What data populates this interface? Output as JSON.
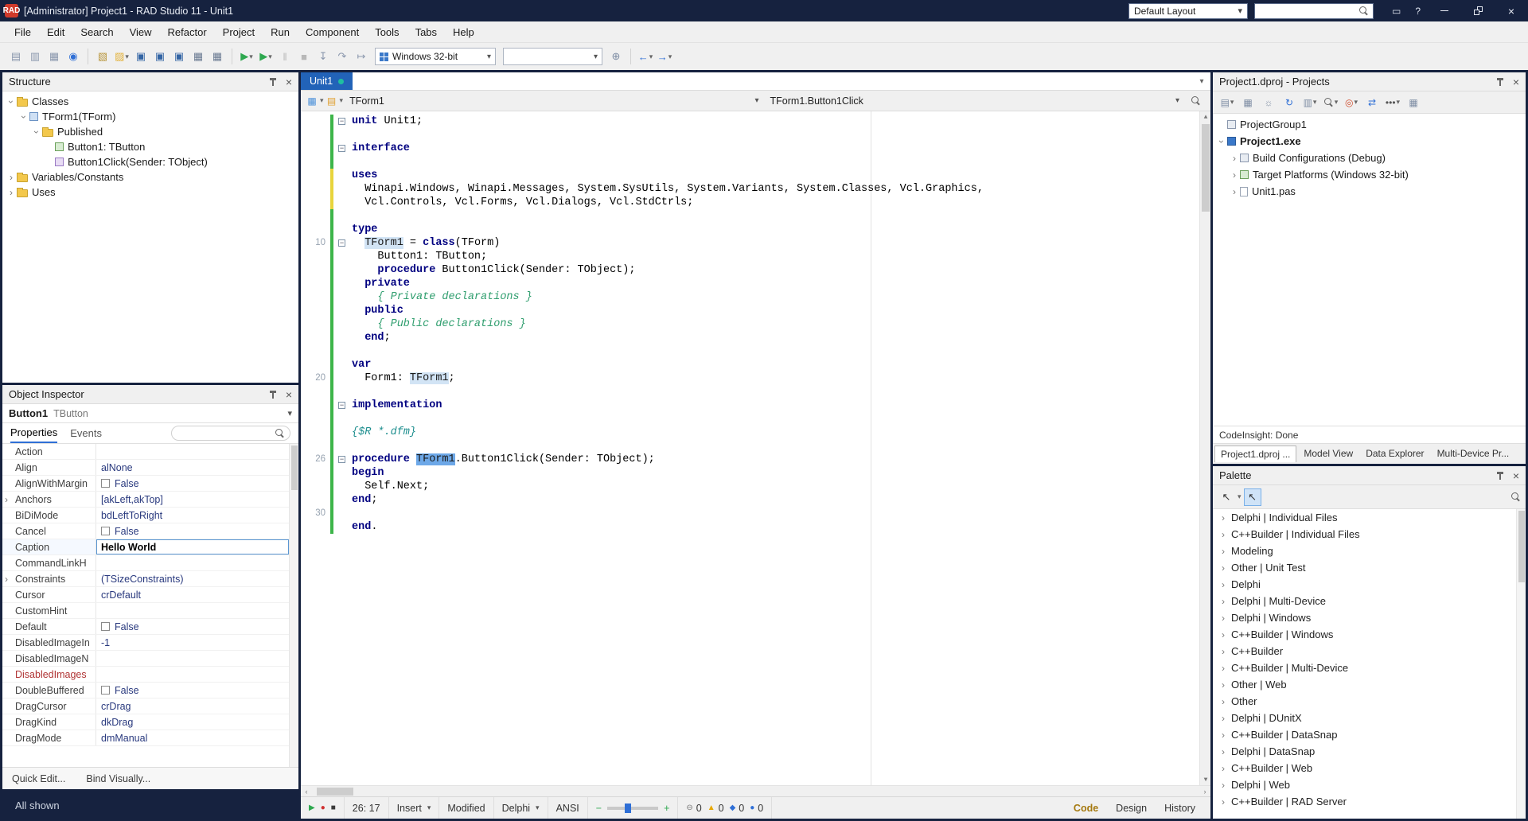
{
  "colors": {
    "titlebar_bg": "#16223f",
    "active_tab_bg": "#2263b8",
    "modified_dot": "#1fbfa0",
    "change_bar_saved": "#3db54a",
    "change_bar_unsaved": "#e8d43c",
    "keyword": "#000080",
    "comment": "#2f9e6e",
    "selection": "#6da8e8",
    "occurrence": "#d2e4f5",
    "accent": "#2f6fd6"
  },
  "titlebar": {
    "title": "[Administrator] Project1 - RAD Studio 11 - Unit1",
    "layout_select": "Default Layout",
    "help_label": "?"
  },
  "menubar": {
    "items": [
      "File",
      "Edit",
      "Search",
      "View",
      "Refactor",
      "Project",
      "Run",
      "Component",
      "Tools",
      "Tabs",
      "Help"
    ]
  },
  "toolbar": {
    "desktop_icons": [
      {
        "name": "new-items-icon",
        "glyph": "▤",
        "color": "#8a97ad"
      },
      {
        "name": "open-items-icon",
        "glyph": "▥",
        "color": "#8a97ad"
      },
      {
        "name": "desktop-layout-icon",
        "glyph": "▦",
        "color": "#8a97ad"
      },
      {
        "name": "help-insight-icon",
        "glyph": "◉",
        "color": "#2f6fd6"
      }
    ],
    "file_icons": [
      {
        "name": "new-unit-icon",
        "glyph": "▧",
        "color": "#b9973f"
      },
      {
        "name": "open-file-icon",
        "glyph": "▨",
        "color": "#e3b23c",
        "dd": true
      },
      {
        "name": "save-icon",
        "glyph": "▣",
        "color": "#3465a4"
      },
      {
        "name": "save-as-icon",
        "glyph": "▣",
        "color": "#3465a4"
      },
      {
        "name": "save-all-icon",
        "glyph": "▣",
        "color": "#3465a4"
      },
      {
        "name": "view-unit-icon",
        "glyph": "▦",
        "color": "#6a7a92"
      },
      {
        "name": "view-form-icon",
        "glyph": "▦",
        "color": "#6a7a92"
      }
    ],
    "run_icons": [
      {
        "name": "run-icon",
        "glyph": "▶",
        "color": "#2ea84f",
        "dd": true
      },
      {
        "name": "run-without-debugging-icon",
        "glyph": "▶",
        "color": "#2ea84f",
        "dd": true
      },
      {
        "name": "pause-icon",
        "glyph": "‖",
        "color": "#b8b8b8"
      },
      {
        "name": "stop-icon",
        "glyph": "■",
        "color": "#b8b8b8"
      },
      {
        "name": "trace-into-icon",
        "glyph": "↧",
        "color": "#8a97ad"
      },
      {
        "name": "step-over-icon",
        "glyph": "↷",
        "color": "#8a97ad"
      },
      {
        "name": "run-to-cursor-icon",
        "glyph": "↦",
        "color": "#8a97ad"
      }
    ],
    "platform_combo": "Windows 32-bit",
    "config_combo": "",
    "target_icon": {
      "name": "target-icon",
      "glyph": "⊕",
      "color": "#7d8ca3"
    },
    "nav_icons": [
      {
        "name": "navigate-back-icon",
        "glyph": "←",
        "color": "#2f6fd6",
        "dd": true
      },
      {
        "name": "navigate-forward-icon",
        "glyph": "→",
        "color": "#2f6fd6",
        "dd": true
      }
    ]
  },
  "structure_panel": {
    "title": "Structure",
    "nodes": [
      {
        "label": "Classes",
        "depth": 0,
        "state": "expanded",
        "icon": "folder"
      },
      {
        "label": "TForm1(TForm)",
        "depth": 1,
        "state": "expanded",
        "icon": "class"
      },
      {
        "label": "Published",
        "depth": 2,
        "state": "expanded",
        "icon": "folder"
      },
      {
        "label": "Button1: TButton",
        "depth": 3,
        "state": "leaf",
        "icon": "member"
      },
      {
        "label": "Button1Click(Sender: TObject)",
        "depth": 3,
        "state": "leaf",
        "icon": "method"
      },
      {
        "label": "Variables/Constants",
        "depth": 0,
        "state": "collapsed",
        "icon": "folder"
      },
      {
        "label": "Uses",
        "depth": 0,
        "state": "collapsed",
        "icon": "folder"
      }
    ]
  },
  "object_inspector": {
    "title": "Object Inspector",
    "instance": "Button1",
    "instance_type": "TButton",
    "tabs": [
      "Properties",
      "Events"
    ],
    "active_tab": "Properties",
    "rows": [
      {
        "name": "Action",
        "value": "",
        "kind": "plain"
      },
      {
        "name": "Align",
        "value": "alNone",
        "kind": "plain"
      },
      {
        "name": "AlignWithMargin",
        "value": "False",
        "kind": "bool"
      },
      {
        "name": "Anchors",
        "value": "[akLeft,akTop]",
        "kind": "plain",
        "expandable": true
      },
      {
        "name": "BiDiMode",
        "value": "bdLeftToRight",
        "kind": "plain"
      },
      {
        "name": "Cancel",
        "value": "False",
        "kind": "bool"
      },
      {
        "name": "Caption",
        "value": "Hello World",
        "kind": "edit",
        "selected": true
      },
      {
        "name": "CommandLinkH",
        "value": "",
        "kind": "plain"
      },
      {
        "name": "Constraints",
        "value": "(TSizeConstraints)",
        "kind": "plain",
        "expandable": true
      },
      {
        "name": "Cursor",
        "value": "crDefault",
        "kind": "plain"
      },
      {
        "name": "CustomHint",
        "value": "",
        "kind": "plain"
      },
      {
        "name": "Default",
        "value": "False",
        "kind": "bool"
      },
      {
        "name": "DisabledImageIn",
        "value": "-1",
        "kind": "plain"
      },
      {
        "name": "DisabledImageN",
        "value": "",
        "kind": "plain"
      },
      {
        "name": "DisabledImages",
        "value": "",
        "kind": "plain",
        "red": true
      },
      {
        "name": "DoubleBuffered",
        "value": "False",
        "kind": "bool"
      },
      {
        "name": "DragCursor",
        "value": "crDrag",
        "kind": "plain"
      },
      {
        "name": "DragKind",
        "value": "dkDrag",
        "kind": "plain"
      },
      {
        "name": "DragMode",
        "value": "dmManual",
        "kind": "plain"
      }
    ],
    "footer_links": [
      "Quick Edit...",
      "Bind Visually..."
    ],
    "filter_status": "All shown"
  },
  "editor": {
    "tab": {
      "label": "Unit1",
      "modified": true
    },
    "breadcrumb": {
      "scope": "TForm1",
      "member": "TForm1.Button1Click"
    },
    "code": {
      "lines": [
        {
          "num": "",
          "bar": "g",
          "fold": true,
          "tokens": [
            [
              "k",
              "unit"
            ],
            [
              "p",
              " Unit1;"
            ]
          ]
        },
        {
          "num": "",
          "bar": "g",
          "tokens": []
        },
        {
          "num": "",
          "bar": "g",
          "fold": true,
          "tokens": [
            [
              "k",
              "interface"
            ]
          ]
        },
        {
          "num": "",
          "bar": "g",
          "tokens": []
        },
        {
          "num": "",
          "bar": "y",
          "tokens": [
            [
              "k",
              "uses"
            ]
          ]
        },
        {
          "num": "",
          "bar": "y",
          "tokens": [
            [
              "p",
              "  Winapi.Windows, Winapi.Messages, System.SysUtils, System.Variants, System.Classes, Vcl.Graphics,"
            ]
          ]
        },
        {
          "num": "",
          "bar": "y",
          "tokens": [
            [
              "p",
              "  Vcl.Controls, Vcl.Forms, Vcl.Dialogs, Vcl.StdCtrls;"
            ]
          ]
        },
        {
          "num": "",
          "bar": "g",
          "tokens": []
        },
        {
          "num": "",
          "bar": "g",
          "tokens": [
            [
              "k",
              "type"
            ]
          ]
        },
        {
          "num": "10",
          "bar": "g",
          "fold": true,
          "tokens": [
            [
              "p",
              "  "
            ],
            [
              "hl",
              "TForm1"
            ],
            [
              "p",
              " = "
            ],
            [
              "k",
              "class"
            ],
            [
              "p",
              "(TForm)"
            ]
          ]
        },
        {
          "num": "",
          "bar": "g",
          "tokens": [
            [
              "p",
              "    Button1: TButton;"
            ]
          ]
        },
        {
          "num": "",
          "bar": "g",
          "tokens": [
            [
              "p",
              "    "
            ],
            [
              "k",
              "procedure"
            ],
            [
              "p",
              " Button1Click(Sender: TObject);"
            ]
          ]
        },
        {
          "num": "",
          "bar": "g",
          "tokens": [
            [
              "p",
              "  "
            ],
            [
              "k",
              "private"
            ]
          ]
        },
        {
          "num": "",
          "bar": "g",
          "tokens": [
            [
              "c",
              "    { Private declarations }"
            ]
          ]
        },
        {
          "num": "",
          "bar": "g",
          "tokens": [
            [
              "p",
              "  "
            ],
            [
              "k",
              "public"
            ]
          ]
        },
        {
          "num": "",
          "bar": "g",
          "tokens": [
            [
              "c",
              "    { Public declarations }"
            ]
          ]
        },
        {
          "num": "",
          "bar": "g",
          "tokens": [
            [
              "p",
              "  "
            ],
            [
              "k",
              "end"
            ],
            [
              "p",
              ";"
            ]
          ]
        },
        {
          "num": "",
          "bar": "g",
          "tokens": []
        },
        {
          "num": "",
          "bar": "g",
          "tokens": [
            [
              "k",
              "var"
            ]
          ]
        },
        {
          "num": "20",
          "bar": "g",
          "tokens": [
            [
              "p",
              "  Form1: "
            ],
            [
              "hl",
              "TForm1"
            ],
            [
              "p",
              ";"
            ]
          ]
        },
        {
          "num": "",
          "bar": "g",
          "tokens": []
        },
        {
          "num": "",
          "bar": "g",
          "fold": true,
          "tokens": [
            [
              "k",
              "implementation"
            ]
          ]
        },
        {
          "num": "",
          "bar": "g",
          "tokens": []
        },
        {
          "num": "",
          "bar": "g",
          "tokens": [
            [
              "d",
              "{$R *.dfm}"
            ]
          ]
        },
        {
          "num": "",
          "bar": "g",
          "tokens": []
        },
        {
          "num": "26",
          "bar": "g",
          "fold": true,
          "tokens": [
            [
              "k",
              "procedure"
            ],
            [
              "p",
              " "
            ],
            [
              "sel",
              "TForm1"
            ],
            [
              "p",
              ".Button1Click(Sender: TObject);"
            ]
          ]
        },
        {
          "num": "",
          "bar": "g",
          "tokens": [
            [
              "k",
              "begin"
            ]
          ]
        },
        {
          "num": "",
          "bar": "g",
          "tokens": [
            [
              "p",
              "  Self.Next;"
            ]
          ]
        },
        {
          "num": "",
          "bar": "g",
          "tokens": [
            [
              "k",
              "end"
            ],
            [
              "p",
              ";"
            ]
          ]
        },
        {
          "num": "30",
          "bar": "g",
          "tokens": []
        },
        {
          "num": "",
          "bar": "g",
          "tokens": [
            [
              "k",
              "end"
            ],
            [
              "p",
              "."
            ]
          ]
        }
      ]
    },
    "status": {
      "caret": "26: 17",
      "mode": "Insert",
      "modified": "Modified",
      "language": "Delphi",
      "encoding": "ANSI",
      "indicators": [
        {
          "name": "errors-indicator",
          "glyph": "⊖",
          "color": "#777777",
          "count": "0"
        },
        {
          "name": "warnings-indicator",
          "glyph": "▲",
          "color": "#e8a800",
          "count": "0"
        },
        {
          "name": "hints-indicator",
          "glyph": "◆",
          "color": "#2f6fd6",
          "count": "0"
        },
        {
          "name": "notes-indicator",
          "glyph": "●",
          "color": "#2f6fd6",
          "count": "0"
        }
      ],
      "views": [
        "Code",
        "Design",
        "History"
      ],
      "active_view": "Code"
    }
  },
  "projects_panel": {
    "title": "Project1.dproj - Projects",
    "toolbar_icons": [
      {
        "name": "project-add-icon",
        "glyph": "▤",
        "color": "#7d8ca3",
        "dd": true
      },
      {
        "name": "project-remove-icon",
        "glyph": "▦",
        "color": "#7d8ca3"
      },
      {
        "name": "project-options-icon",
        "glyph": "☼",
        "color": "#7d8ca3"
      },
      {
        "name": "project-refresh-icon",
        "glyph": "↻",
        "color": "#2f6fd6"
      },
      {
        "name": "project-build-icon",
        "glyph": "▥",
        "color": "#7d8ca3",
        "dd": true
      },
      {
        "name": "project-search-icon",
        "glyph": "search",
        "dd": true
      },
      {
        "name": "project-run-icon",
        "glyph": "◎",
        "color": "#d05030",
        "dd": true
      },
      {
        "name": "project-sync-icon",
        "glyph": "⇄",
        "color": "#2f6fd6"
      },
      {
        "name": "project-more-icon",
        "glyph": "•••",
        "color": "#555555",
        "dd": true
      },
      {
        "name": "project-grid-icon",
        "glyph": "▦",
        "color": "#7d8ca3"
      }
    ],
    "nodes": [
      {
        "label": "ProjectGroup1",
        "depth": 0,
        "state": "leaf",
        "icon": "group",
        "bold": false
      },
      {
        "label": "Project1.exe",
        "depth": 0,
        "state": "expanded",
        "icon": "app",
        "bold": true
      },
      {
        "label": "Build Configurations (Debug)",
        "depth": 1,
        "state": "collapsed",
        "icon": "config",
        "bold": false
      },
      {
        "label": "Target Platforms (Windows 32-bit)",
        "depth": 1,
        "state": "collapsed",
        "icon": "platform",
        "bold": false
      },
      {
        "label": "Unit1.pas",
        "depth": 1,
        "state": "collapsed",
        "icon": "unit",
        "bold": false
      }
    ],
    "codeinsight": "CodeInsight: Done",
    "tabs": [
      "Project1.dproj ...",
      "Model View",
      "Data Explorer",
      "Multi-Device Pr..."
    ],
    "active_tab": "Project1.dproj ..."
  },
  "palette_panel": {
    "title": "Palette",
    "categories": [
      "Delphi | Individual Files",
      "C++Builder | Individual Files",
      "Modeling",
      "Other | Unit Test",
      "Delphi",
      "Delphi | Multi-Device",
      "Delphi | Windows",
      "C++Builder | Windows",
      "C++Builder",
      "C++Builder | Multi-Device",
      "Other | Web",
      "Other",
      "Delphi | DUnitX",
      "C++Builder | DataSnap",
      "Delphi | DataSnap",
      "C++Builder | Web",
      "Delphi | Web",
      "C++Builder | RAD Server"
    ]
  }
}
